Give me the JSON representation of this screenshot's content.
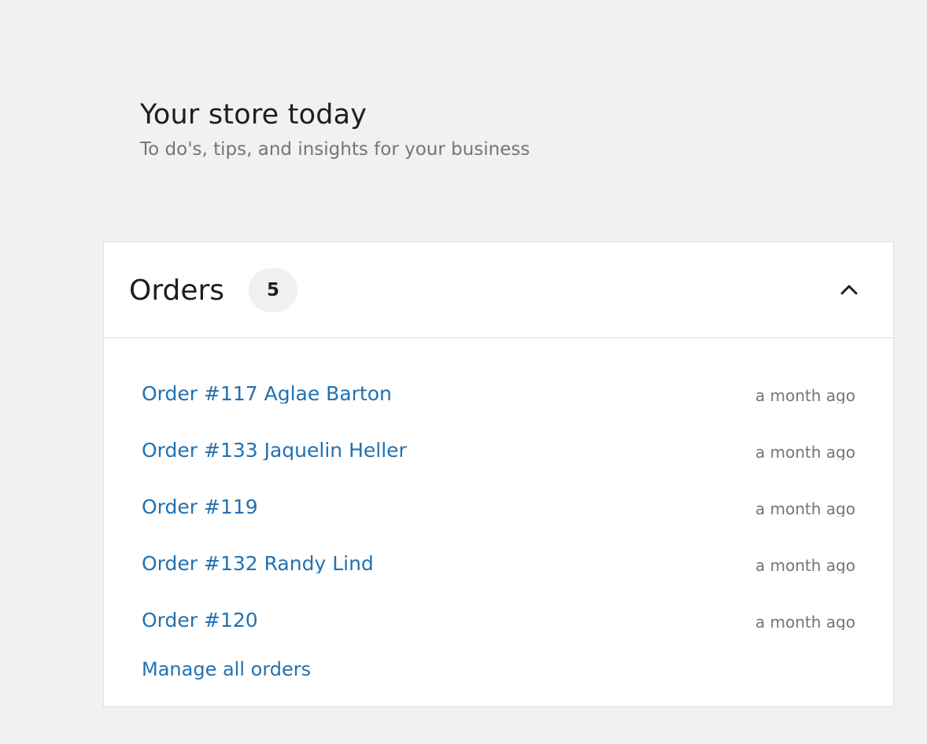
{
  "header": {
    "title": "Your store today",
    "subtitle": "To do's, tips, and insights for your business"
  },
  "orders_card": {
    "title": "Orders",
    "count": "5",
    "toggle_icon": "chevron-up-icon",
    "orders": [
      {
        "label": "Order #117 Aglae Barton",
        "time": "a month ago"
      },
      {
        "label": "Order #133 Jaquelin Heller",
        "time": "a month ago"
      },
      {
        "label": "Order #119",
        "time": "a month ago"
      },
      {
        "label": "Order #132 Randy Lind",
        "time": "a month ago"
      },
      {
        "label": "Order #120",
        "time": "a month ago"
      }
    ],
    "manage_link": "Manage all orders"
  },
  "colors": {
    "background": "#f1f1f1",
    "card": "#ffffff",
    "link": "#2271b1",
    "muted_text": "#757575",
    "badge": "#f0f0f0"
  }
}
